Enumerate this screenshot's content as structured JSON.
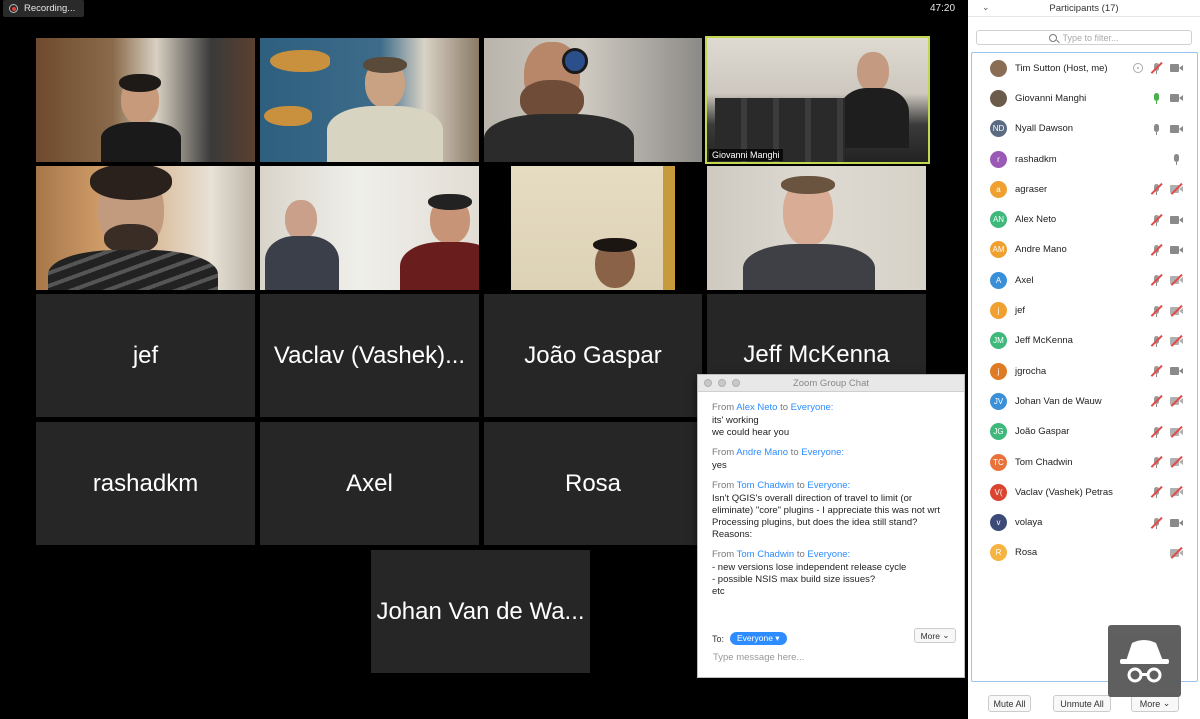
{
  "top": {
    "recording_label": "Recording...",
    "timer": "47:20"
  },
  "active_speaker_label": "Giovanni Manghi",
  "name_tiles": [
    "jef",
    "Vaclav (Vashek)...",
    "João Gaspar",
    "Jeff McKenna",
    "rashadkm",
    "Axel",
    "Rosa",
    "Johan Van de Wa..."
  ],
  "chat": {
    "title": "Zoom Group Chat",
    "messages": [
      {
        "from": "Alex Neto",
        "to": "Everyone",
        "lines": [
          "its' working",
          "we could hear you"
        ]
      },
      {
        "from": "Andre Mano",
        "to": "Everyone",
        "lines": [
          "yes"
        ]
      },
      {
        "from": "Tom Chadwin",
        "to": "Everyone",
        "lines": [
          "Isn't QGIS's overall direction of travel to limit (or",
          "eliminate) \"core\" plugins - I appreciate this was not wrt",
          "Processing plugins, but does the idea still stand?",
          "Reasons:"
        ]
      },
      {
        "from": "Tom Chadwin",
        "to": "Everyone",
        "lines": [
          "- new versions lose independent release cycle",
          "- possible NSIS max build size issues?",
          "etc"
        ]
      }
    ],
    "from_word": "From",
    "to_word": "to",
    "to_label": "To:",
    "to_value": "Everyone",
    "more_label": "More",
    "input_placeholder": "Type message here..."
  },
  "participants": {
    "title": "Participants (17)",
    "filter_placeholder": "Type to filter...",
    "list": [
      {
        "name": "Tim Sutton (Host, me)",
        "initials": "",
        "color": "#8a6d55",
        "mic": "muted",
        "cam": "on",
        "host": true
      },
      {
        "name": "Giovanni Manghi",
        "initials": "",
        "color": "#6a5b4a",
        "mic": "on",
        "cam": "on",
        "host": false
      },
      {
        "name": "Nyall Dawson",
        "initials": "ND",
        "color": "#5b6b82",
        "mic": "plain",
        "cam": "on",
        "host": false
      },
      {
        "name": "rashadkm",
        "initials": "r",
        "color": "#9b59b6",
        "mic": "plain",
        "cam": "none",
        "host": false
      },
      {
        "name": "agraser",
        "initials": "a",
        "color": "#f0a030",
        "mic": "muted",
        "cam": "off",
        "host": false
      },
      {
        "name": "Alex Neto",
        "initials": "AN",
        "color": "#3fb87b",
        "mic": "muted",
        "cam": "on",
        "host": false
      },
      {
        "name": "Andre Mano",
        "initials": "AM",
        "color": "#f0a030",
        "mic": "muted",
        "cam": "on",
        "host": false
      },
      {
        "name": "Axel",
        "initials": "A",
        "color": "#3a8fd9",
        "mic": "muted",
        "cam": "off",
        "host": false
      },
      {
        "name": "jef",
        "initials": "j",
        "color": "#f0a030",
        "mic": "muted",
        "cam": "off",
        "host": false
      },
      {
        "name": "Jeff McKenna",
        "initials": "JM",
        "color": "#3fb87b",
        "mic": "muted",
        "cam": "off",
        "host": false
      },
      {
        "name": "jgrocha",
        "initials": "j",
        "color": "#e07b25",
        "mic": "muted",
        "cam": "on",
        "host": false
      },
      {
        "name": "Johan Van de Wauw",
        "initials": "JV",
        "color": "#3a8fd9",
        "mic": "muted",
        "cam": "off",
        "host": false
      },
      {
        "name": "João Gaspar",
        "initials": "JG",
        "color": "#3fb87b",
        "mic": "muted",
        "cam": "off",
        "host": false
      },
      {
        "name": "Tom Chadwin",
        "initials": "TC",
        "color": "#e8733a",
        "mic": "muted",
        "cam": "off",
        "host": false
      },
      {
        "name": "Vaclav (Vashek) Petras",
        "initials": "V(",
        "color": "#d9452f",
        "mic": "muted",
        "cam": "off",
        "host": false
      },
      {
        "name": "volaya",
        "initials": "v",
        "color": "#3c4a78",
        "mic": "muted",
        "cam": "on",
        "host": false
      },
      {
        "name": "Rosa",
        "initials": "R",
        "color": "#f5b342",
        "mic": "none",
        "cam": "off",
        "host": false
      }
    ],
    "mute_all": "Mute All",
    "unmute_all": "Unmute All",
    "more": "More"
  }
}
